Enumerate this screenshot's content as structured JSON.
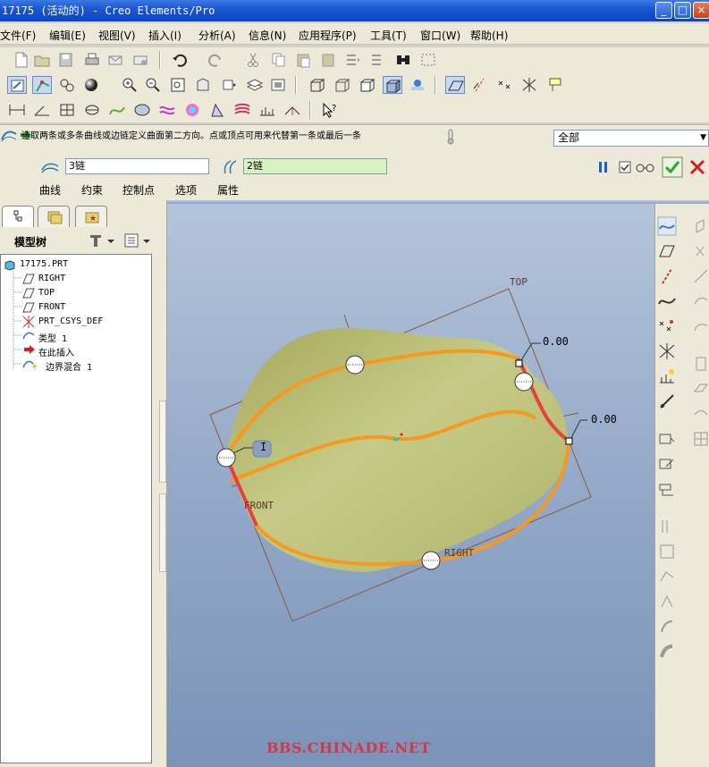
{
  "window": {
    "title": "17175 (活动的) - Creo Elements/Pro",
    "min_label": "_",
    "max_label": "□",
    "close_label": "×"
  },
  "menu": [
    "文件(F)",
    "编辑(E)",
    "视图(V)",
    "插入(I)",
    "分析(A)",
    "信息(N)",
    "应用程序(P)",
    "工具(T)",
    "窗口(W)",
    "帮助(H)"
  ],
  "dashboard": {
    "message": "选取两条或多条曲线或边链定义曲面第二方向。点或顶点可用来代替第一条或最后一条",
    "filter_value": "全部",
    "chain_first": "3链",
    "chain_second": "2链",
    "tabs": [
      "曲线",
      "约束",
      "控制点",
      "选项",
      "属性"
    ]
  },
  "model_tree": {
    "header": "模型树",
    "items": [
      "17175.PRT",
      "RIGHT",
      "TOP",
      "FRONT",
      "PRT_CSYS_DEF",
      "类型 1",
      "在此插入",
      "边界混合 1"
    ]
  },
  "graphics": {
    "labels": {
      "top": "TOP",
      "front": "FRONT",
      "right": "RIGHT",
      "dim1": "0.00",
      "dim2": "0.00",
      "marker": "I"
    }
  },
  "watermark": "BBS.CHINADE.NET",
  "colors": {
    "titlebar": "#0b46c0",
    "surface": "#b9bd72",
    "curve": "#f59a1e",
    "edge": "#e8403a",
    "accept": "#2fa52f",
    "cancel": "#d02020"
  }
}
